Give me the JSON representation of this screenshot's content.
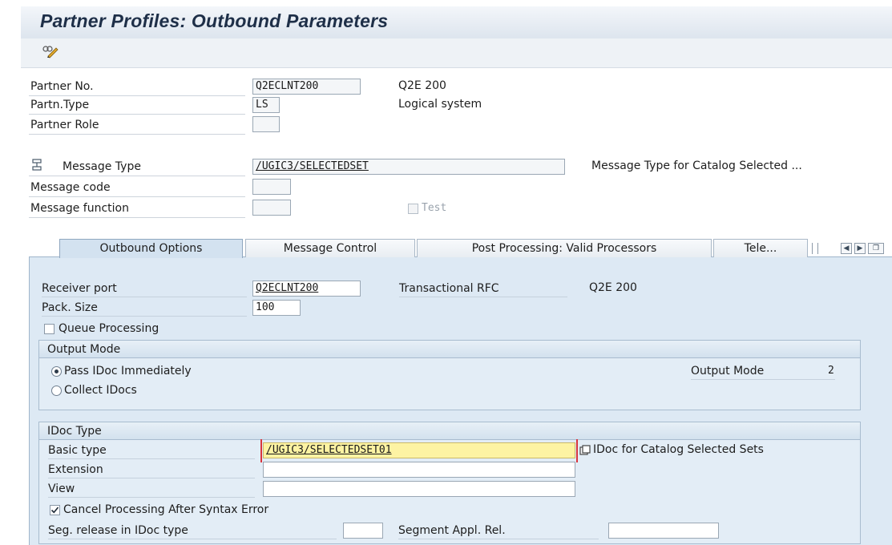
{
  "window": {
    "title": "Partner Profiles: Outbound Parameters"
  },
  "toolbar": {
    "display_change_icon": "display-change-icon"
  },
  "header": {
    "partner_no": {
      "label": "Partner No.",
      "value": "Q2ECLNT200",
      "desc": "Q2E 200"
    },
    "partn_type": {
      "label": "Partn.Type",
      "value": "LS",
      "desc": "Logical system"
    },
    "partner_role": {
      "label": "Partner Role",
      "value": ""
    },
    "message_type": {
      "label": "Message Type",
      "value": "/UGIC3/SELECTEDSET",
      "desc": "Message Type for Catalog Selected ..."
    },
    "message_code": {
      "label": "Message code",
      "value": ""
    },
    "message_function": {
      "label": "Message function",
      "value": ""
    },
    "test": {
      "label": "Test",
      "checked": false
    }
  },
  "tabs": [
    {
      "label": "Outbound Options",
      "active": true
    },
    {
      "label": "Message Control",
      "active": false
    },
    {
      "label": "Post Processing: Valid Processors",
      "active": false
    },
    {
      "label": "Tele...",
      "active": false
    }
  ],
  "outbound": {
    "receiver_port": {
      "label": "Receiver port",
      "value": "Q2ECLNT200",
      "port_type": "Transactional RFC",
      "desc": "Q2E 200"
    },
    "pack_size": {
      "label": "Pack. Size",
      "value": "100"
    },
    "queue_processing": {
      "label": "Queue Processing",
      "checked": false
    },
    "output_mode": {
      "title": "Output Mode",
      "pass_immediately": {
        "label": "Pass IDoc Immediately",
        "selected": true
      },
      "collect": {
        "label": "Collect IDocs",
        "selected": false
      },
      "mode_label": "Output Mode",
      "mode_value": "2"
    },
    "idoc_type": {
      "title": "IDoc Type",
      "basic_type": {
        "label": "Basic type",
        "value": "/UGIC3/SELECTEDSET01",
        "desc": "IDoc for Catalog Selected Sets"
      },
      "extension": {
        "label": "Extension",
        "value": ""
      },
      "view": {
        "label": "View",
        "value": ""
      },
      "cancel_processing": {
        "label": "Cancel Processing After Syntax Error",
        "checked": true
      },
      "seg_release": {
        "label": "Seg. release in IDoc type",
        "value": ""
      },
      "segment_appl_rel": {
        "label": "Segment Appl. Rel.",
        "value": ""
      }
    }
  }
}
